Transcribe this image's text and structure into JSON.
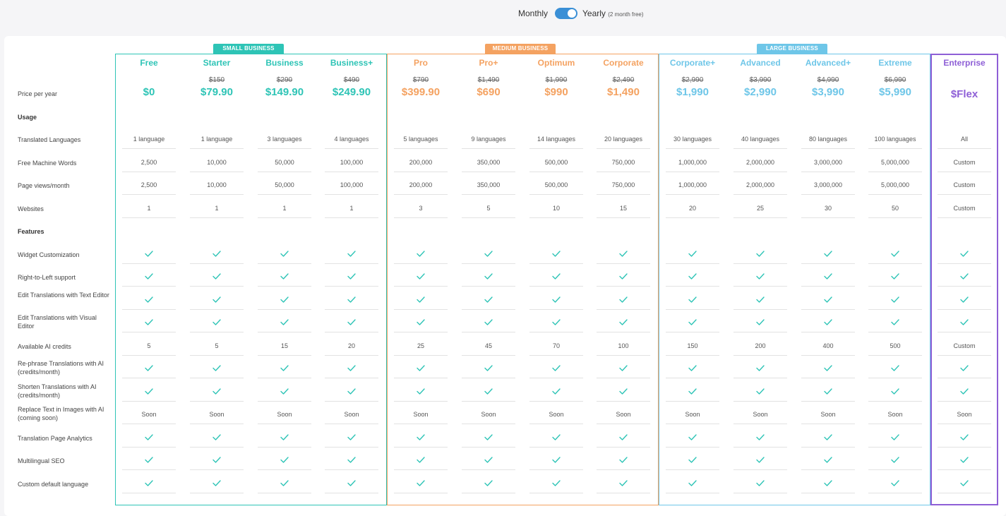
{
  "billing": {
    "monthly_label": "Monthly",
    "yearly_label": "Yearly",
    "yearly_note": "(2 month free)",
    "yearly_selected": true
  },
  "groups": [
    {
      "label": "SMALL BUSINESS",
      "color": "#2ec4b6"
    },
    {
      "label": "MEDIUM BUSINESS",
      "color": "#f4a261"
    },
    {
      "label": "LARGE BUSINESS",
      "color": "#6ec6e8"
    },
    {
      "label": "",
      "color": "#8e5fd6"
    }
  ],
  "plans": [
    {
      "name": "Free",
      "old_price": "",
      "price": "$0",
      "group": 0
    },
    {
      "name": "Starter",
      "old_price": "$150",
      "price": "$79.90",
      "group": 0
    },
    {
      "name": "Business",
      "old_price": "$290",
      "price": "$149.90",
      "group": 0
    },
    {
      "name": "Business+",
      "old_price": "$490",
      "price": "$249.90",
      "group": 0
    },
    {
      "name": "Pro",
      "old_price": "$790",
      "price": "$399.90",
      "group": 1
    },
    {
      "name": "Pro+",
      "old_price": "$1,490",
      "price": "$690",
      "group": 1
    },
    {
      "name": "Optimum",
      "old_price": "$1,990",
      "price": "$990",
      "group": 1
    },
    {
      "name": "Corporate",
      "old_price": "$2,490",
      "price": "$1,490",
      "group": 1
    },
    {
      "name": "Corporate+",
      "old_price": "$2,990",
      "price": "$1,990",
      "group": 2
    },
    {
      "name": "Advanced",
      "old_price": "$3,990",
      "price": "$2,990",
      "group": 2
    },
    {
      "name": "Advanced+",
      "old_price": "$4,990",
      "price": "$3,990",
      "group": 2
    },
    {
      "name": "Extreme",
      "old_price": "$6,990",
      "price": "$5,990",
      "group": 2
    },
    {
      "name": "Enterprise",
      "old_price": "",
      "price": "$Flex",
      "group": 3
    }
  ],
  "rows": [
    {
      "label": "Price per year",
      "type": "label"
    },
    {
      "label": "Usage",
      "type": "section"
    },
    {
      "label": "Translated Languages",
      "type": "values",
      "values": [
        "1 language",
        "1 language",
        "3 languages",
        "4 languages",
        "5 languages",
        "9 languages",
        "14 languages",
        "20 languages",
        "30 languages",
        "40 languages",
        "80 languages",
        "100 languages",
        "All"
      ]
    },
    {
      "label": "Free Machine Words",
      "type": "values",
      "values": [
        "2,500",
        "10,000",
        "50,000",
        "100,000",
        "200,000",
        "350,000",
        "500,000",
        "750,000",
        "1,000,000",
        "2,000,000",
        "3,000,000",
        "5,000,000",
        "Custom"
      ]
    },
    {
      "label": "Page views/month",
      "type": "values",
      "values": [
        "2,500",
        "10,000",
        "50,000",
        "100,000",
        "200,000",
        "350,000",
        "500,000",
        "750,000",
        "1,000,000",
        "2,000,000",
        "3,000,000",
        "5,000,000",
        "Custom"
      ]
    },
    {
      "label": "Websites",
      "type": "values",
      "values": [
        "1",
        "1",
        "1",
        "1",
        "3",
        "5",
        "10",
        "15",
        "20",
        "25",
        "30",
        "50",
        "Custom"
      ]
    },
    {
      "label": "Features",
      "type": "section"
    },
    {
      "label": "Widget Customization",
      "type": "check"
    },
    {
      "label": "Right-to-Left support",
      "type": "check"
    },
    {
      "label": "Edit Translations with Text Editor",
      "type": "check"
    },
    {
      "label": "Edit Translations with Visual Editor",
      "type": "check"
    },
    {
      "label": "Available AI credits",
      "type": "values",
      "values": [
        "5",
        "5",
        "15",
        "20",
        "25",
        "45",
        "70",
        "100",
        "150",
        "200",
        "400",
        "500",
        "Custom"
      ]
    },
    {
      "label": "Re-phrase Translations with AI (credits/month)",
      "type": "check"
    },
    {
      "label": "Shorten Translations with AI (credits/month)",
      "type": "check"
    },
    {
      "label": "Replace Text in Images with AI (coming soon)",
      "type": "values",
      "values": [
        "Soon",
        "Soon",
        "Soon",
        "Soon",
        "Soon",
        "Soon",
        "Soon",
        "Soon",
        "Soon",
        "Soon",
        "Soon",
        "Soon",
        "Soon"
      ]
    },
    {
      "label": "Translation Page Analytics",
      "type": "check"
    },
    {
      "label": "Multilingual SEO",
      "type": "check"
    },
    {
      "label": "Custom default language",
      "type": "check"
    }
  ],
  "colors": {
    "check": "#2ec4b6",
    "toggle_on": "#3a8fd6"
  }
}
